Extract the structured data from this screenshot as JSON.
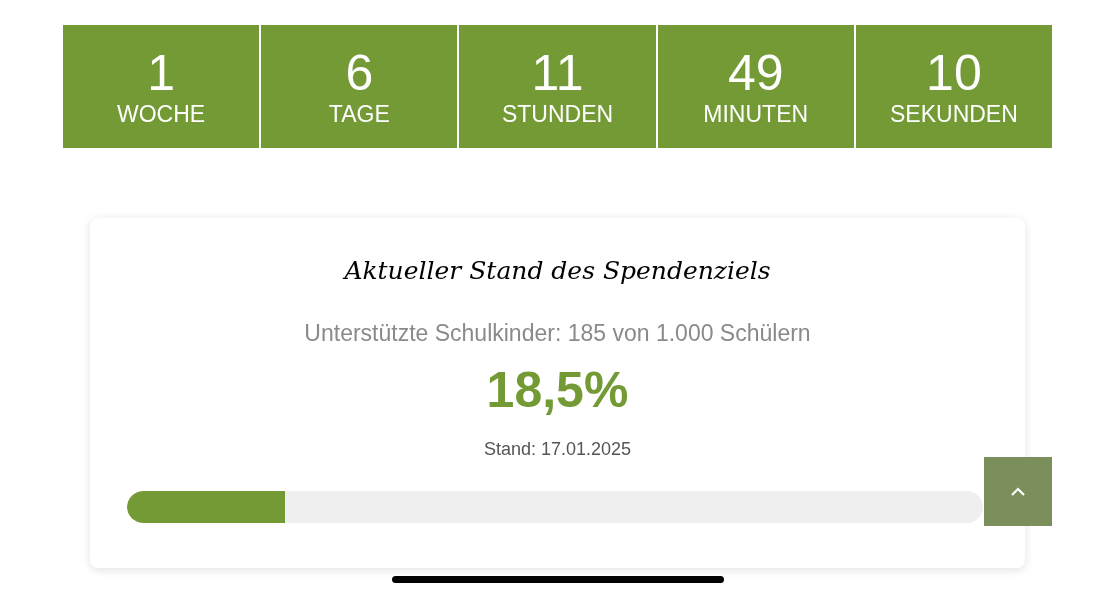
{
  "countdown": [
    {
      "value": "1",
      "unit": "WOCHE"
    },
    {
      "value": "6",
      "unit": "TAGE"
    },
    {
      "value": "11",
      "unit": "STUNDEN"
    },
    {
      "value": "49",
      "unit": "MINUTEN"
    },
    {
      "value": "10",
      "unit": "SEKUNDEN"
    }
  ],
  "goal": {
    "title": "Aktueller Stand des Spendenziels",
    "subtitle": "Unterstützte Schulkinder: 185 von 1.000 Schülern",
    "percent": "18,5%",
    "date": "Stand: 17.01.2025",
    "level": 0.185
  }
}
